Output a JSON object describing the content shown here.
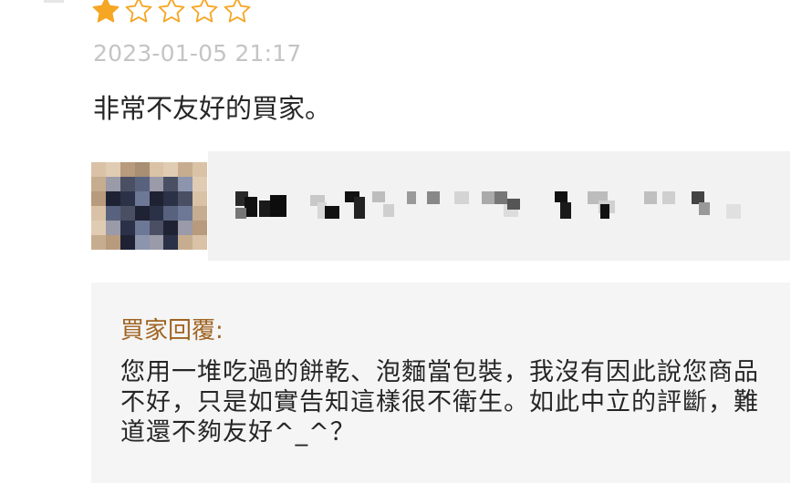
{
  "review": {
    "rating": 1,
    "max_rating": 5,
    "star_color": "#f5a623",
    "timestamp": "2023-01-05 21:17",
    "text": "非常不友好的買家。"
  },
  "product": {
    "thumbnail_icon": "pixelated-product-image",
    "name_icon": "pixelated-product-name"
  },
  "seller_reply": {
    "label": "買家回覆:",
    "text": "您用一堆吃過的餅乾、泡麵當包裝，我沒有因此說您商品不好，只是如實告知這樣很不衛生。如此中立的評斷，難道還不夠友好^_^？",
    "label_color": "#a06422"
  }
}
